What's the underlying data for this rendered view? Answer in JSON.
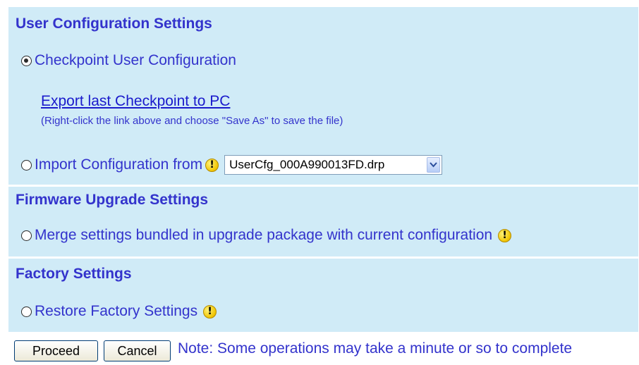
{
  "user_config": {
    "title": "User Configuration Settings",
    "checkpoint_label": "Checkpoint User Configuration",
    "export_link": "Export last Checkpoint to PC",
    "export_hint": "(Right-click the link above and choose \"Save As\" to save the file)",
    "import_label": "Import Configuration from",
    "import_file_selected": "UserCfg_000A990013FD.drp"
  },
  "firmware": {
    "title": "Firmware Upgrade Settings",
    "merge_label": "Merge settings bundled in upgrade package with current configuration"
  },
  "factory": {
    "title": "Factory Settings",
    "restore_label": "Restore Factory Settings"
  },
  "actions": {
    "proceed_label": "Proceed",
    "cancel_label": "Cancel",
    "note": "Note: Some operations may take a minute or so to complete"
  },
  "selected_option": "checkpoint",
  "colors": {
    "panel_bg": "#d0ebf7",
    "text": "#3333cc",
    "link": "#1a1acc",
    "warning": "#f0c400"
  },
  "icons": [
    "warning-icon",
    "chevron-down-icon"
  ]
}
